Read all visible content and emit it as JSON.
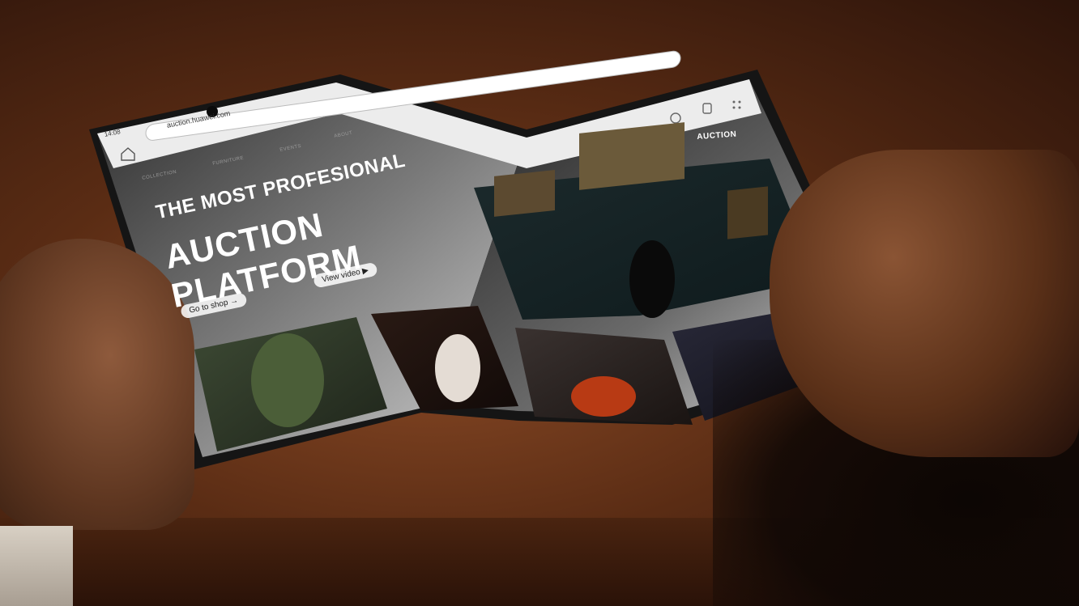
{
  "screen": {
    "status_time": "14:08",
    "url": "auction.huawei.com",
    "brand": "AUCTION",
    "nav_items": [
      "COLLECTION",
      "FURNITURE",
      "EVENTS",
      "ABOUT"
    ],
    "hero": {
      "line1": "THE MOST PROFESIONAL",
      "line2": "AUCTION",
      "line3": "PLATFORM"
    },
    "buttons": {
      "shop": "Go to shop →",
      "video": "View video ▶"
    }
  },
  "colors": {
    "table": "#6a3418",
    "screen_light": "#e8e8e8",
    "screen_dark": "#3a3a3a",
    "device_frame": "#151515"
  },
  "icons": [
    "home-icon",
    "lock-icon",
    "search-icon",
    "share-icon",
    "menu-icon",
    "camera-icon"
  ]
}
